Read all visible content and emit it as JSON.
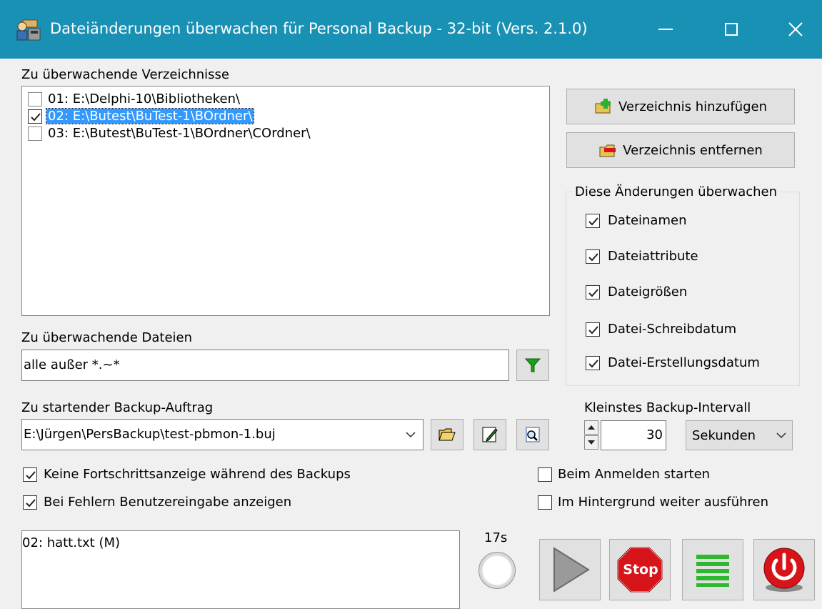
{
  "window": {
    "title": "Dateiänderungen überwachen für Personal Backup - 32-bit (Vers. 2.1.0)",
    "min_symbol": "—",
    "max_symbol": "☐",
    "close_symbol": "✕"
  },
  "folders": {
    "label": "Zu überwachende Verzeichnisse",
    "items": [
      {
        "text": "01: E:\\Delphi-10\\Bibliotheken\\",
        "checked": false,
        "selected": false
      },
      {
        "text": "02: E:\\Butest\\BuTest-1\\BOrdner\\",
        "checked": true,
        "selected": true
      },
      {
        "text": "03: E:\\Butest\\BuTest-1\\BOrdner\\COrdner\\",
        "checked": false,
        "selected": false
      }
    ],
    "add_button": "Verzeichnis hinzufügen",
    "remove_button": "Verzeichnis entfernen"
  },
  "changes": {
    "label": "Diese Änderungen überwachen",
    "options": [
      "Dateinamen",
      "Dateiattribute",
      "Dateigrößen",
      "Datei-Schreibdatum",
      "Datei-Erstellungsdatum"
    ]
  },
  "files": {
    "label": "Zu überwachende Dateien",
    "value": "alle außer *.~*"
  },
  "job": {
    "label": "Zu startender Backup-Auftrag",
    "value": "E:\\Jürgen\\PersBackup\\test-pbmon-1.buj"
  },
  "interval": {
    "label": "Kleinstes Backup-Intervall",
    "value": "30",
    "unit": "Sekunden"
  },
  "options": {
    "no_progress": "Keine Fortschrittsanzeige während des Backups",
    "show_input": "Bei Fehlern Benutzereingabe anzeigen",
    "start_login": "Beim Anmelden starten",
    "background": "Im Hintergrund weiter ausführen"
  },
  "log": {
    "text": "02: hatt.txt (M)",
    "timer": "17s"
  },
  "actions": {
    "stop_label": "Stop"
  },
  "colors": {
    "titlebar": "#1991b5",
    "selection": "#3399ff",
    "stop": "#d7141a"
  }
}
